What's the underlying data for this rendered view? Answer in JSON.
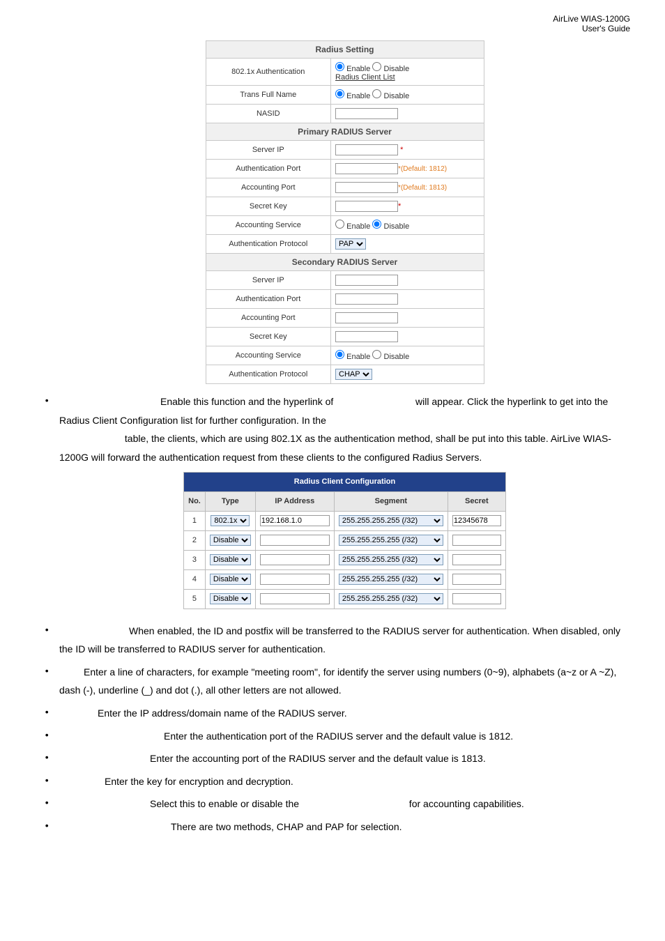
{
  "header": {
    "brand": "AirLive WIAS-1200G",
    "sub": "User's Guide"
  },
  "radius_setting": {
    "title": "Radius Setting",
    "auth_label": "802.1x Authentication",
    "auth_enable": "Enable",
    "auth_disable": "Disable",
    "client_list_link": "Radius Client List",
    "trans_label": "Trans Full Name",
    "trans_enable": "Enable",
    "trans_disable": "Disable",
    "nasid_label": "NASID"
  },
  "primary": {
    "title": "Primary RADIUS Server",
    "server_ip": "Server IP",
    "auth_port": "Authentication Port",
    "auth_port_hint": "*(Default: 1812)",
    "acct_port": "Accounting Port",
    "acct_port_hint": "*(Default: 1813)",
    "secret": "Secret Key",
    "acct_service": "Accounting Service",
    "acct_enable": "Enable",
    "acct_disable": "Disable",
    "auth_proto": "Authentication Protocol",
    "auth_proto_val": "PAP"
  },
  "secondary": {
    "title": "Secondary RADIUS Server",
    "server_ip": "Server IP",
    "auth_port": "Authentication Port",
    "acct_port": "Accounting Port",
    "secret": "Secret Key",
    "acct_service": "Accounting Service",
    "acct_enable": "Enable",
    "acct_disable": "Disable",
    "auth_proto": "Authentication Protocol",
    "auth_proto_val": "CHAP"
  },
  "client_cfg": {
    "title": "Radius Client Configuration",
    "cols": {
      "no": "No.",
      "type": "Type",
      "ip": "IP Address",
      "seg": "Segment",
      "secret": "Secret"
    },
    "rows": [
      {
        "no": "1",
        "type": "802.1x",
        "ip": "192.168.1.0",
        "seg": "255.255.255.255 (/32)",
        "secret": "12345678"
      },
      {
        "no": "2",
        "type": "Disable",
        "ip": "",
        "seg": "255.255.255.255 (/32)",
        "secret": ""
      },
      {
        "no": "3",
        "type": "Disable",
        "ip": "",
        "seg": "255.255.255.255 (/32)",
        "secret": ""
      },
      {
        "no": "4",
        "type": "Disable",
        "ip": "",
        "seg": "255.255.255.255 (/32)",
        "secret": ""
      },
      {
        "no": "5",
        "type": "Disable",
        "ip": "",
        "seg": "255.255.255.255 (/32)",
        "secret": ""
      }
    ]
  },
  "bullets": {
    "b1a": "Enable this function and the hyperlink of ",
    "b1b": " will appear. Click the hyperlink to get into the Radius Client Configuration list for further configuration. In the ",
    "b1c": " table, the clients, which are using 802.1X as the authentication method, shall be put into this table. AirLive WIAS-1200G will forward the authentication request from these clients to the configured Radius Servers.",
    "b2": "When enabled, the ID and postfix will be transferred to the RADIUS server for authentication. When disabled, only the ID will be transferred to RADIUS server for authentication.",
    "b3": "Enter a line of characters, for example \"meeting room\", for identify the server using numbers (0~9), alphabets (a~z or A ~Z), dash (-), underline (_) and dot (.), all other letters are not allowed.",
    "b4": "Enter the IP address/domain name of the RADIUS server.",
    "b5": "Enter the authentication port of the RADIUS server and the default value is 1812.",
    "b6": "Enter the accounting port of the RADIUS server and the default value is 1813.",
    "b7": "Enter the key for encryption and decryption.",
    "b8a": "Select this to enable or disable the ",
    "b8b": " for accounting capabilities.",
    "b9": "There are two methods, CHAP and PAP for selection."
  }
}
